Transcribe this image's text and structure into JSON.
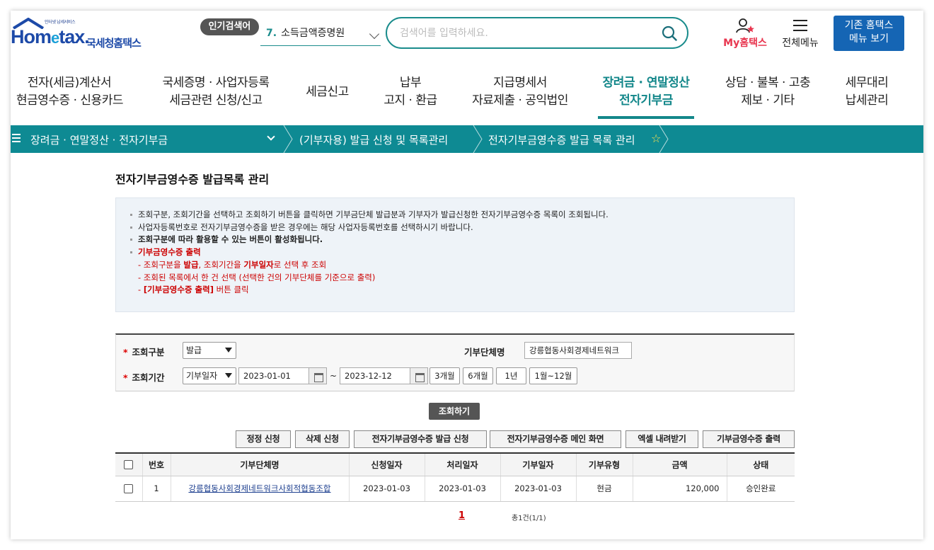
{
  "header": {
    "logo_sub": "인터넷 납세서비스",
    "logo_main_left": "Hom",
    "logo_main_e": "e",
    "logo_main_right": "tax.",
    "logo_korean": "국세청홈택스",
    "popular_badge": "인기검색어",
    "popular_rank": "7.",
    "popular_term": "소득금액증명원",
    "search_placeholder": "검색어를 입력하세요.",
    "my_hometax": "My홈택스",
    "all_menu": "전체메뉴",
    "old_site_line1": "기존 홈택스",
    "old_site_line2": "메뉴 보기"
  },
  "nav": [
    {
      "line1": "전자(세금)계산서",
      "line2": "현금영수증 · 신용카드"
    },
    {
      "line1": "국세증명 · 사업자등록",
      "line2": "세금관련 신청/신고"
    },
    {
      "line1": "세금신고",
      "line2": ""
    },
    {
      "line1": "납부",
      "line2": "고지 · 환급"
    },
    {
      "line1": "지급명세서",
      "line2": "자료제출 · 공익법인"
    },
    {
      "line1": "장려금 · 연말정산",
      "line2": "전자기부금"
    },
    {
      "line1": "상담 · 불복 · 고충",
      "line2": "제보 · 기타"
    },
    {
      "line1": "세무대리",
      "line2": "납세관리"
    }
  ],
  "breadcrumb": {
    "level1": "장려금 · 연말정산 · 전자기부금",
    "level2": "(기부자용) 발급 신청 및 목록관리",
    "level3": "전자기부금영수증 발급 목록 관리"
  },
  "page_title": "전자기부금영수증 발급목록 관리",
  "notice": {
    "line1": "조회구분, 조회기간을 선택하고 조회하기 버튼을 클릭하면 기부금단체 발급분과 기부자가 발급신청한 전자기부금영수증 목록이 조회됩니다.",
    "line2": "사업자등록번호로 전자기부금영수증을 받은 경우에는 해당 사업자등록번호를 선택하시기 바랍니다.",
    "line3": "조회구분에 따라 활용할 수 있는 버튼이 활성화됩니다.",
    "line4": "기부금영수증 출력",
    "line5_a": "- 조회구분을 ",
    "line5_b": "발급",
    "line5_c": ", 조회기간을 ",
    "line5_d": "기부일자",
    "line5_e": "로 선택 후 조회",
    "line6": "- 조회된 목록에서 한 건 선택 (선택한 건의 기부단체를 기준으로 출력)",
    "line7_a": "- ",
    "line7_b": "[기부금영수증 출력]",
    "line7_c": " 버튼 클릭"
  },
  "search": {
    "type_label": "조회구분",
    "type_value": "발급",
    "org_label": "기부단체명",
    "org_value": "강릉협동사회경제네트워크",
    "period_label": "조회기간",
    "period_type": "기부일자",
    "date_from": "2023-01-01",
    "date_sep": "~",
    "date_to": "2023-12-12",
    "btn_3m": "3개월",
    "btn_6m": "6개월",
    "btn_1y": "1년",
    "btn_full": "1월~12월",
    "query_btn": "조회하기"
  },
  "actions": {
    "correction": "정정 신청",
    "delete": "삭제 신청",
    "issue": "전자기부금영수증 발급 신청",
    "main": "전자기부금영수증 메인 화면",
    "excel": "엑셀 내려받기",
    "print": "기부금영수증 출력"
  },
  "table": {
    "headers": [
      "번호",
      "기부단체명",
      "신청일자",
      "처리일자",
      "기부일자",
      "기부유형",
      "금액",
      "상태"
    ],
    "rows": [
      [
        "1",
        "강릉협동사회경제네트워크사회적협동조합",
        "2023-01-03",
        "2023-01-03",
        "2023-01-03",
        "현금",
        "120,000",
        "승인완료"
      ]
    ]
  },
  "pager": {
    "current": "1",
    "total": "총1건(1/1)"
  },
  "colors": {
    "teal": "#0e8a93",
    "brand_blue": "#1d4aa8",
    "accent_red": "#e8364f"
  }
}
